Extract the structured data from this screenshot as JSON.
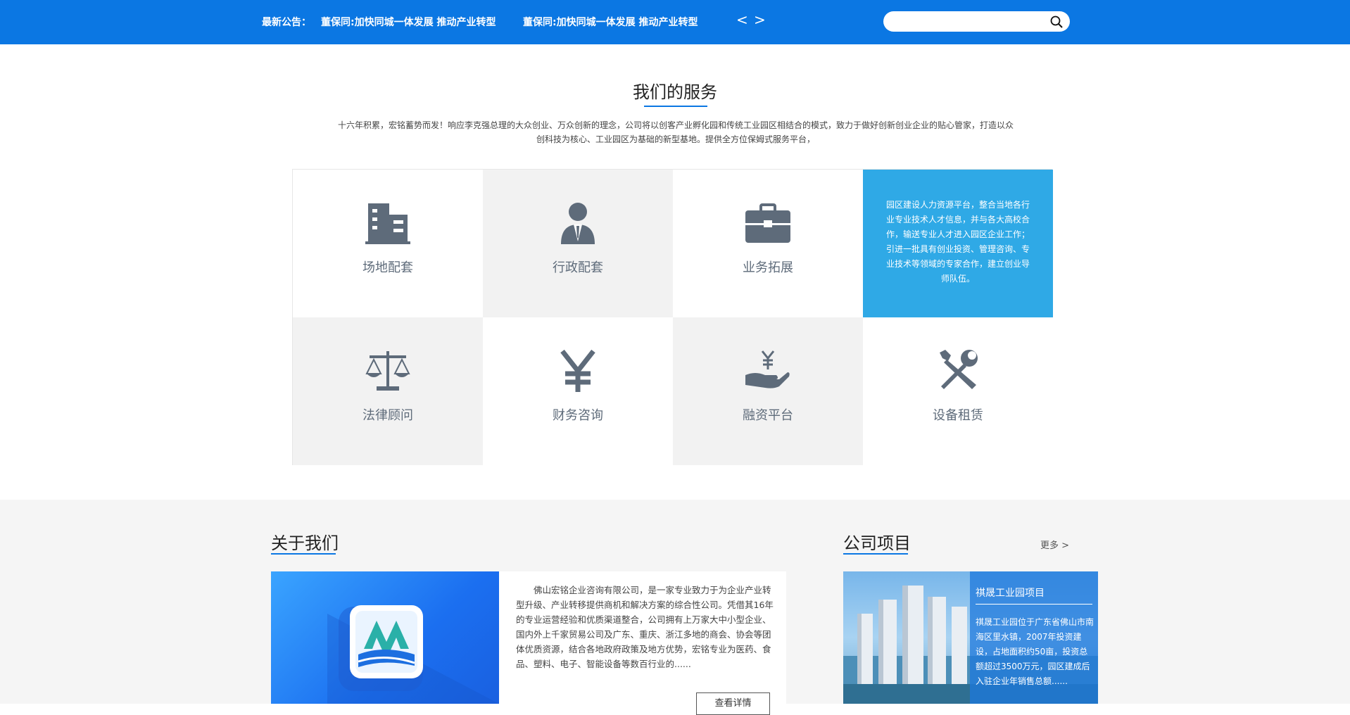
{
  "topbar": {
    "notice_label": "最新公告：",
    "notices": [
      "董保同:加快同城一体发展 推动产业转型",
      "董保同:加快同城一体发展 推动产业转型"
    ],
    "prev": "<",
    "next": ">",
    "search_placeholder": "",
    "accent_color": "#0b77e3"
  },
  "services": {
    "title": "我们的服务",
    "description": "十六年积累，宏铭蓄势而发！响应李克强总理的大众创业、万众创新的理念，公司将以创客产业孵化园和传统工业园区相结合的模式，致力于做好创新创业企业的贴心管家，打造以众创科技为核心、工业园区为基础的新型基地。提供全方位保姆式服务平台，",
    "items": [
      {
        "label": "场地配套",
        "icon": "building-icon"
      },
      {
        "label": "行政配套",
        "icon": "person-tie-icon"
      },
      {
        "label": "业务拓展",
        "icon": "briefcase-icon"
      },
      {
        "label": "",
        "icon": "",
        "hover_text": "园区建设人力资源平台，整合当地各行业专业技术人才信息，并与各大高校合作，输送专业人才进入园区企业工作；引进一批具有创业投资、管理咨询、专业技术等领域的专家合作，建立创业导师队伍。"
      },
      {
        "label": "法律顾问",
        "icon": "scales-icon"
      },
      {
        "label": "财务咨询",
        "icon": "yen-icon"
      },
      {
        "label": "融资平台",
        "icon": "hand-yen-icon"
      },
      {
        "label": "设备租赁",
        "icon": "tools-icon"
      }
    ]
  },
  "about": {
    "title": "关于我们",
    "text": "佛山宏铭企业咨询有限公司，是一家专业致力于为企业产业转型升级、产业转移提供商机和解决方案的综合性公司。凭借其16年的专业运营经验和优质渠道整合，公司拥有上万家大中小型企业、国内外上千家贸易公司及广东、重庆、浙江多地的商会、协会等团体优质资源，结合各地政府政策及地方优势，宏铭专业为医药、食品、塑料、电子、智能设备等数百行业的......",
    "detail_button": "查看详情"
  },
  "projects": {
    "title": "公司项目",
    "more": "更多 >",
    "item": {
      "title": "祺晟工业园项目",
      "desc": "祺晟工业园位于广东省佛山市南海区里水镇，2007年投资建设，占地面积约50亩，投资总额超过3500万元，园区建成后入驻企业年销售总额......"
    }
  }
}
